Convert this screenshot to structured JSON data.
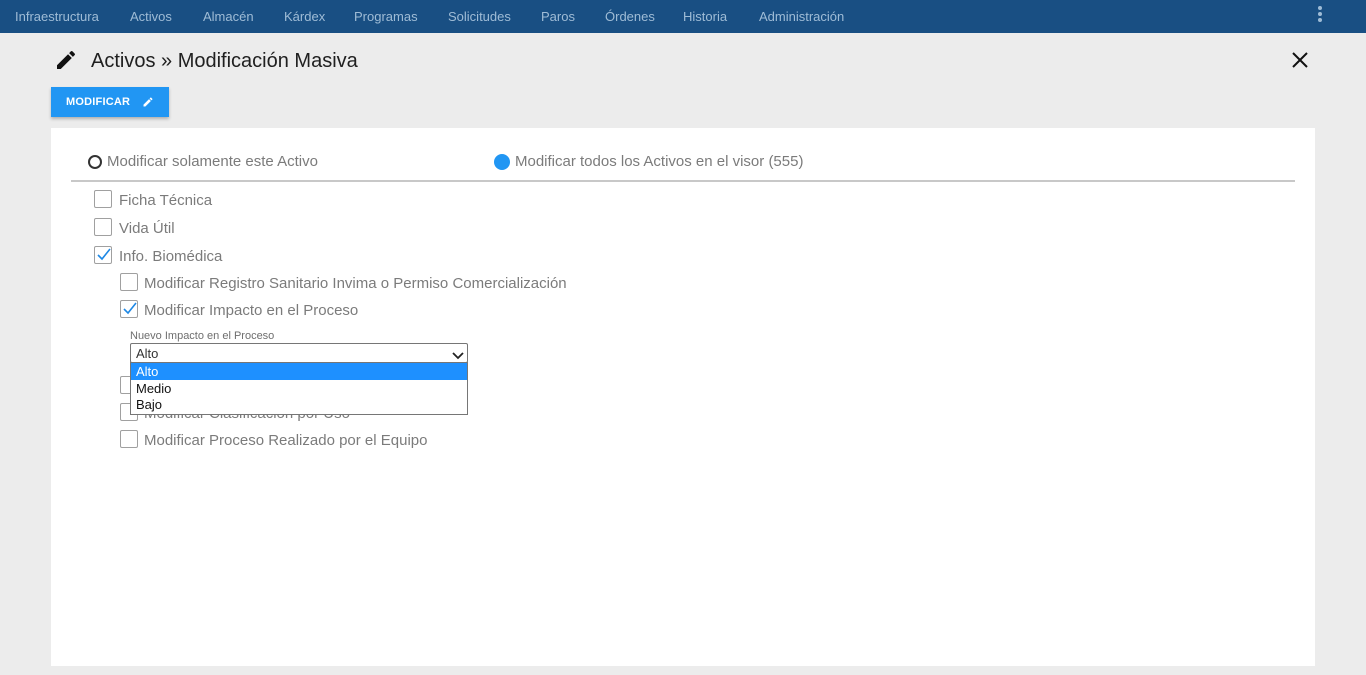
{
  "nav": {
    "items": [
      "Infraestructura",
      "Activos",
      "Almacén",
      "Kárdex",
      "Programas",
      "Solicitudes",
      "Paros",
      "Órdenes",
      "Historia",
      "Administración"
    ],
    "menu_icon": "kebab-vertical-icon"
  },
  "header": {
    "icon": "pencil-icon",
    "title": "Activos » Modificación Masiva",
    "close_icon": "close-icon"
  },
  "toolbar": {
    "modify_label": "MODIFICAR",
    "modify_icon": "pencil-icon"
  },
  "scope": {
    "options": [
      {
        "label": "Modificar solamente este Activo",
        "selected": false
      },
      {
        "label": "Modificar todos los Activos en el visor (555)",
        "selected": true
      }
    ]
  },
  "sections": [
    {
      "label": "Ficha Técnica",
      "checked": false
    },
    {
      "label": "Vida Útil",
      "checked": false
    },
    {
      "label": "Info. Biomédica",
      "checked": true
    }
  ],
  "biomedica_options": [
    {
      "label": "Modificar Registro Sanitario Invima o Permiso Comercialización",
      "checked": false
    },
    {
      "label": "Modificar Impacto en el Proceso",
      "checked": true
    },
    {
      "label": "",
      "checked": false
    },
    {
      "label": "Modificar Clasificación por Uso",
      "checked": false
    },
    {
      "label": "Modificar Proceso Realizado por el Equipo",
      "checked": false
    }
  ],
  "impact_select": {
    "label": "Nuevo Impacto en el Proceso",
    "value": "Alto",
    "options": [
      "Alto",
      "Medio",
      "Bajo"
    ],
    "highlighted": "Alto"
  },
  "colors": {
    "nav_bg": "#194f83",
    "accent": "#2196f3",
    "highlight": "#1e90ff"
  }
}
